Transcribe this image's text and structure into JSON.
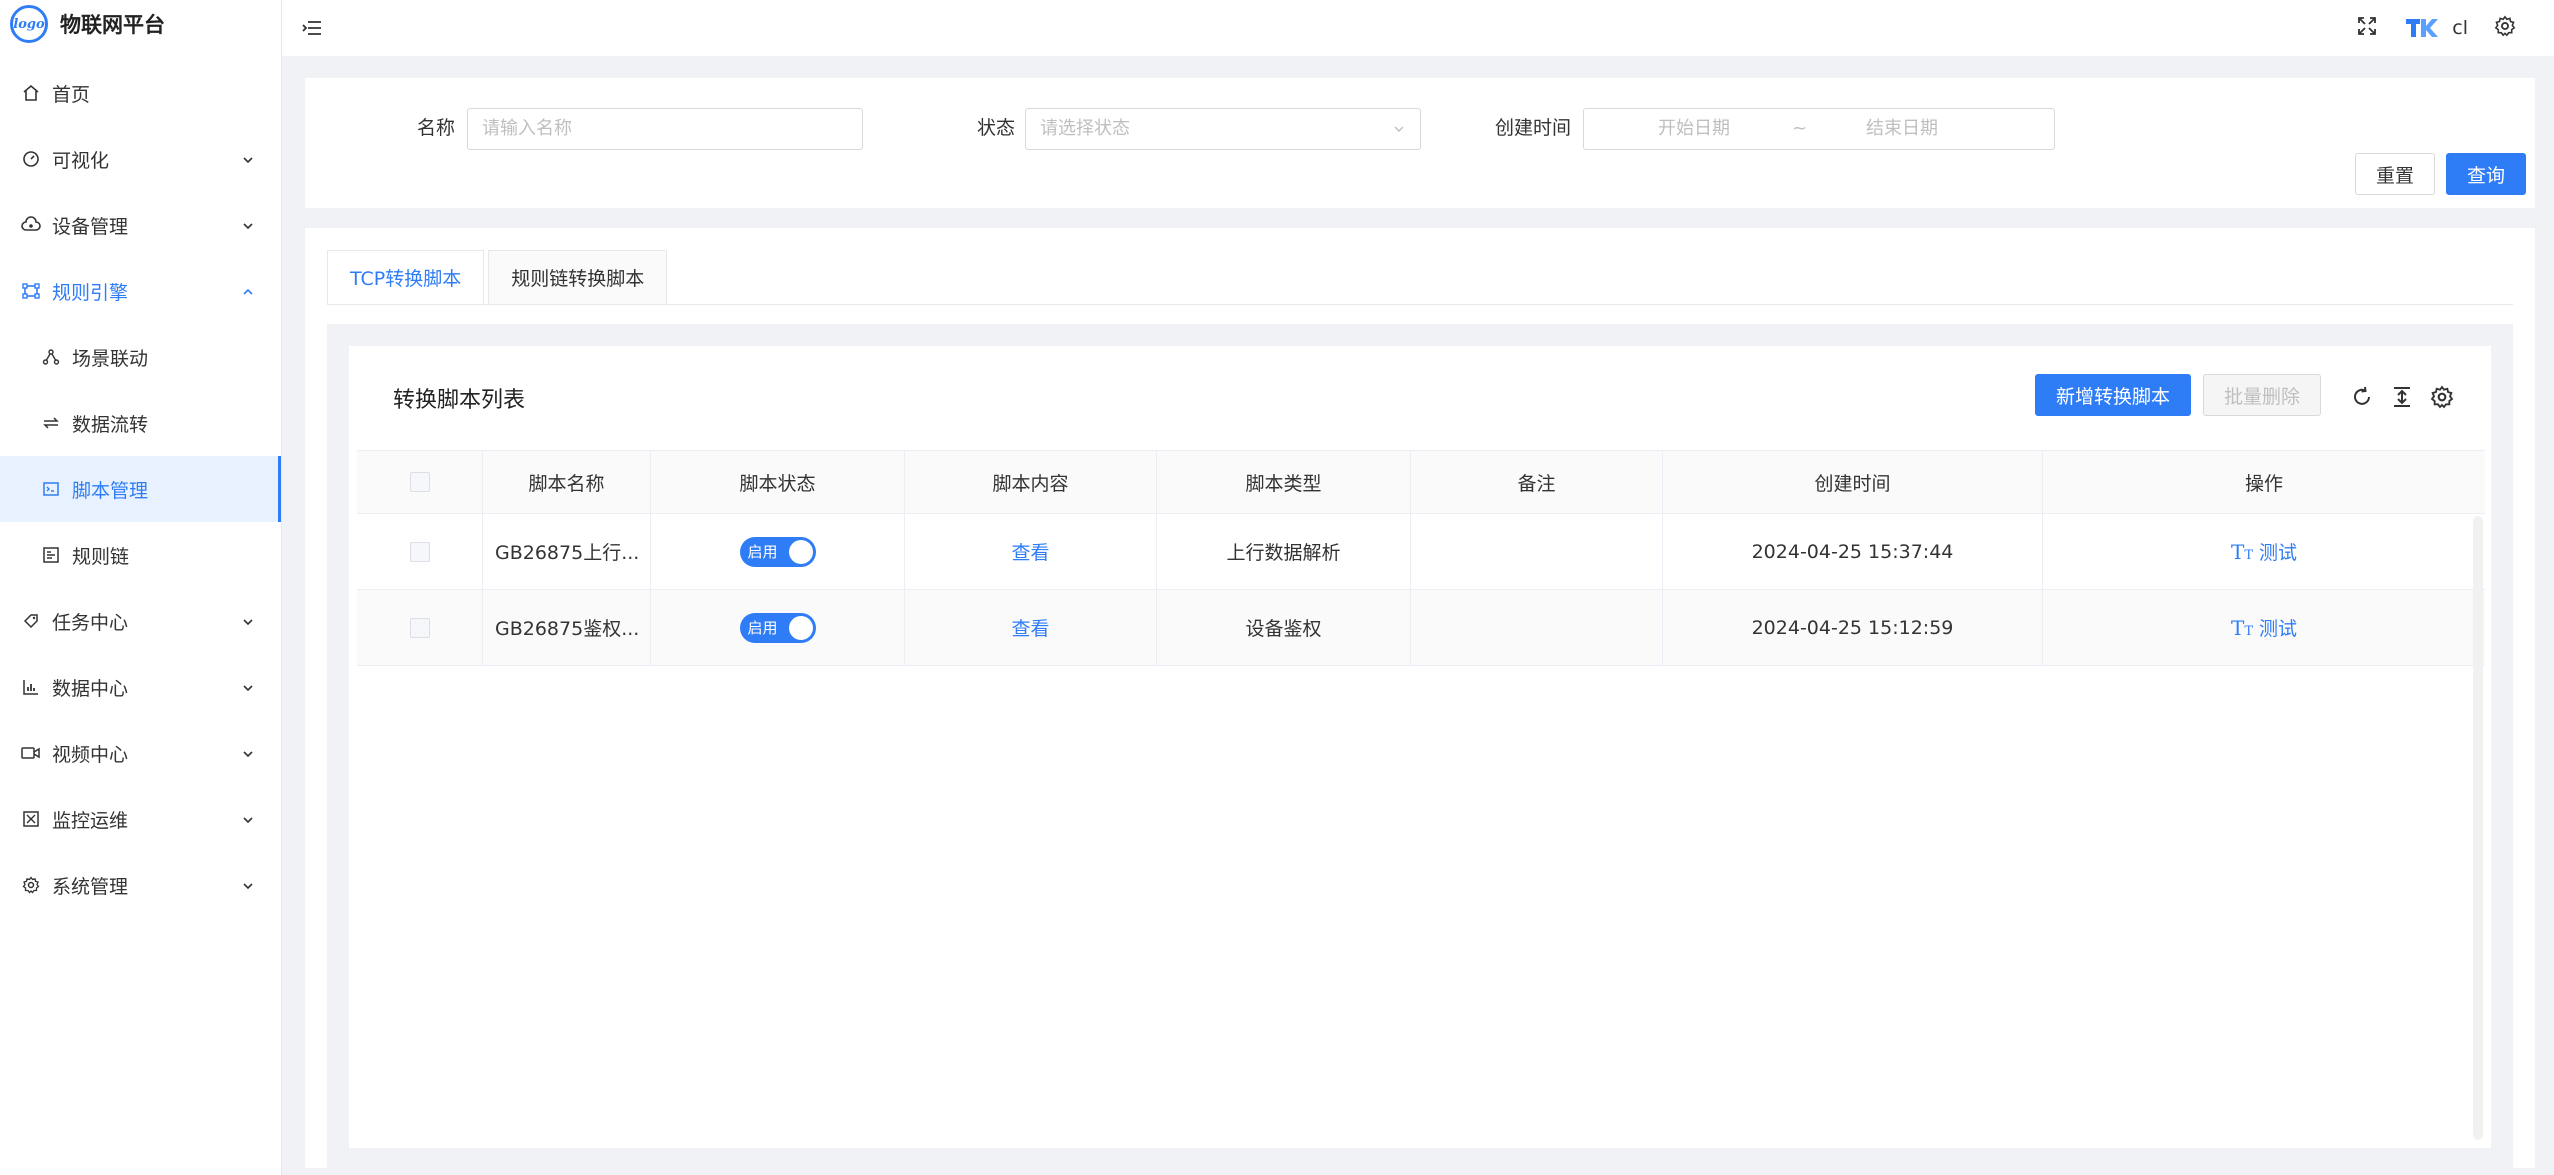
{
  "app": {
    "title": "物联网平台",
    "logo_text": "logo"
  },
  "sidebar": {
    "items": [
      {
        "label": "首页",
        "icon": "home-icon"
      },
      {
        "label": "可视化",
        "icon": "dashboard-icon"
      },
      {
        "label": "设备管理",
        "icon": "cloud-device-icon"
      },
      {
        "label": "规则引擎",
        "icon": "rule-engine-icon"
      },
      {
        "label": "场景联动",
        "icon": "scene-icon"
      },
      {
        "label": "数据流转",
        "icon": "transfer-icon"
      },
      {
        "label": "脚本管理",
        "icon": "script-icon"
      },
      {
        "label": "规则链",
        "icon": "rule-chain-icon"
      },
      {
        "label": "任务中心",
        "icon": "task-icon"
      },
      {
        "label": "数据中心",
        "icon": "chart-icon"
      },
      {
        "label": "视频中心",
        "icon": "video-icon"
      },
      {
        "label": "监控运维",
        "icon": "monitor-icon"
      },
      {
        "label": "系统管理",
        "icon": "settings-icon"
      }
    ]
  },
  "header": {
    "user": "cl"
  },
  "search": {
    "name_label": "名称",
    "name_placeholder": "请输入名称",
    "status_label": "状态",
    "status_placeholder": "请选择状态",
    "time_label": "创建时间",
    "start_placeholder": "开始日期",
    "range_sep": "~",
    "end_placeholder": "结束日期",
    "reset_label": "重置",
    "query_label": "查询"
  },
  "tabs": [
    {
      "label": "TCP转换脚本"
    },
    {
      "label": "规则链转换脚本"
    }
  ],
  "card": {
    "title": "转换脚本列表",
    "add_label": "新增转换脚本",
    "batch_delete_label": "批量删除"
  },
  "table": {
    "columns": [
      "脚本名称",
      "脚本状态",
      "脚本内容",
      "脚本类型",
      "备注",
      "创建时间",
      "操作"
    ],
    "rows": [
      {
        "name": "GB26875上行...",
        "status": "启用",
        "content": "查看",
        "type": "上行数据解析",
        "remark": "",
        "created": "2024-04-25 15:37:44",
        "action": "测试"
      },
      {
        "name": "GB26875鉴权...",
        "status": "启用",
        "content": "查看",
        "type": "设备鉴权",
        "remark": "",
        "created": "2024-04-25 15:12:59",
        "action": "测试"
      }
    ]
  },
  "colors": {
    "primary": "#2f7df6",
    "active_bg": "#e8f1ff"
  }
}
